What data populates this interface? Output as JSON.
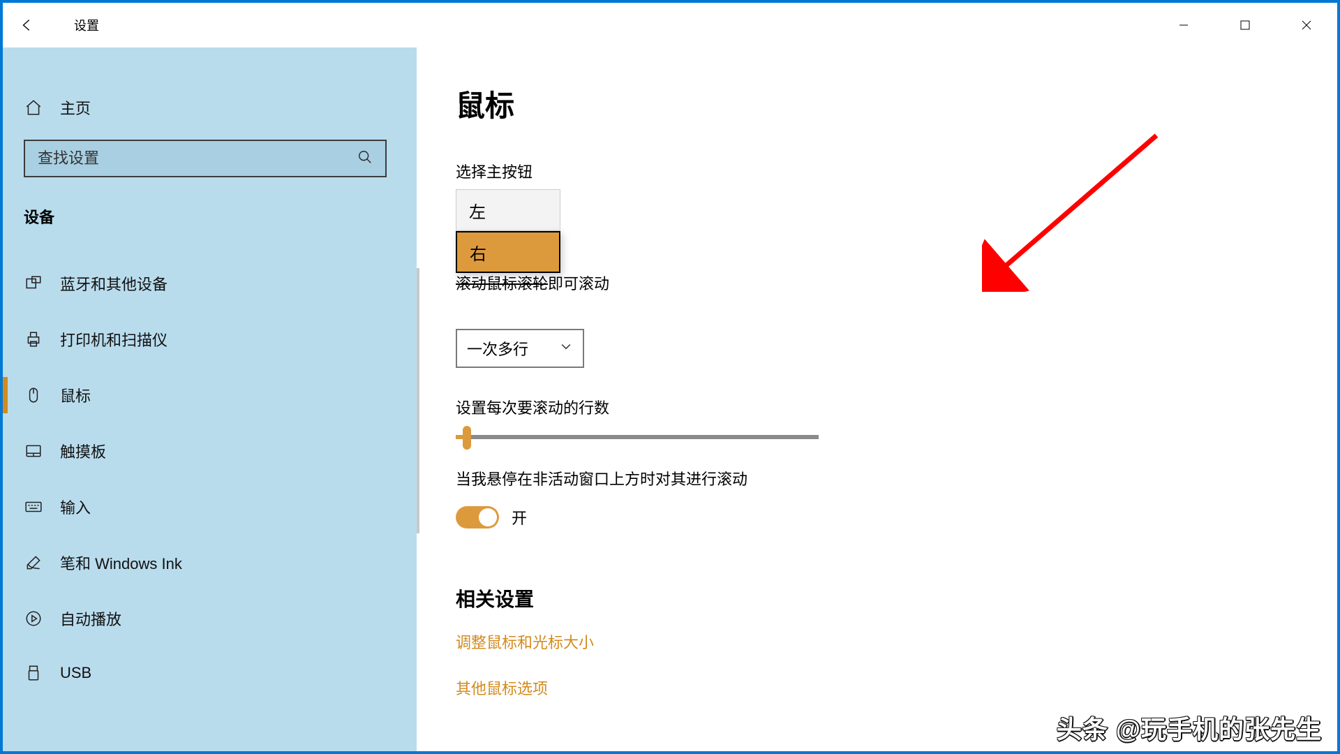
{
  "window": {
    "title": "设置",
    "win_controls": {
      "min": "—",
      "max": "□",
      "close": "✕"
    }
  },
  "sidebar": {
    "home_label": "主页",
    "search_placeholder": "查找设置",
    "group_label": "设备",
    "items": [
      {
        "label": "蓝牙和其他设备",
        "icon": "bluetooth"
      },
      {
        "label": "打印机和扫描仪",
        "icon": "printer"
      },
      {
        "label": "鼠标",
        "icon": "mouse",
        "active": true
      },
      {
        "label": "触摸板",
        "icon": "touchpad"
      },
      {
        "label": "输入",
        "icon": "keyboard"
      },
      {
        "label": "笔和 Windows Ink",
        "icon": "pen"
      },
      {
        "label": "自动播放",
        "icon": "autoplay"
      },
      {
        "label": "USB",
        "icon": "usb"
      }
    ]
  },
  "main": {
    "heading": "鼠标",
    "primary_button": {
      "label": "选择主按钮",
      "options": [
        "左",
        "右"
      ],
      "selected": "右"
    },
    "scroll_behind_text_a": "滚动鼠标滚轮",
    "scroll_behind_text_b": "即可滚动",
    "scroll_mode": {
      "value": "一次多行"
    },
    "lines_label": "设置每次要滚动的行数",
    "hover_label": "当我悬停在非活动窗口上方时对其进行滚动",
    "toggle_state": "开",
    "related_heading": "相关设置",
    "links": [
      "调整鼠标和光标大小",
      "其他鼠标选项"
    ]
  },
  "watermark": "头条 @玩手机的张先生"
}
